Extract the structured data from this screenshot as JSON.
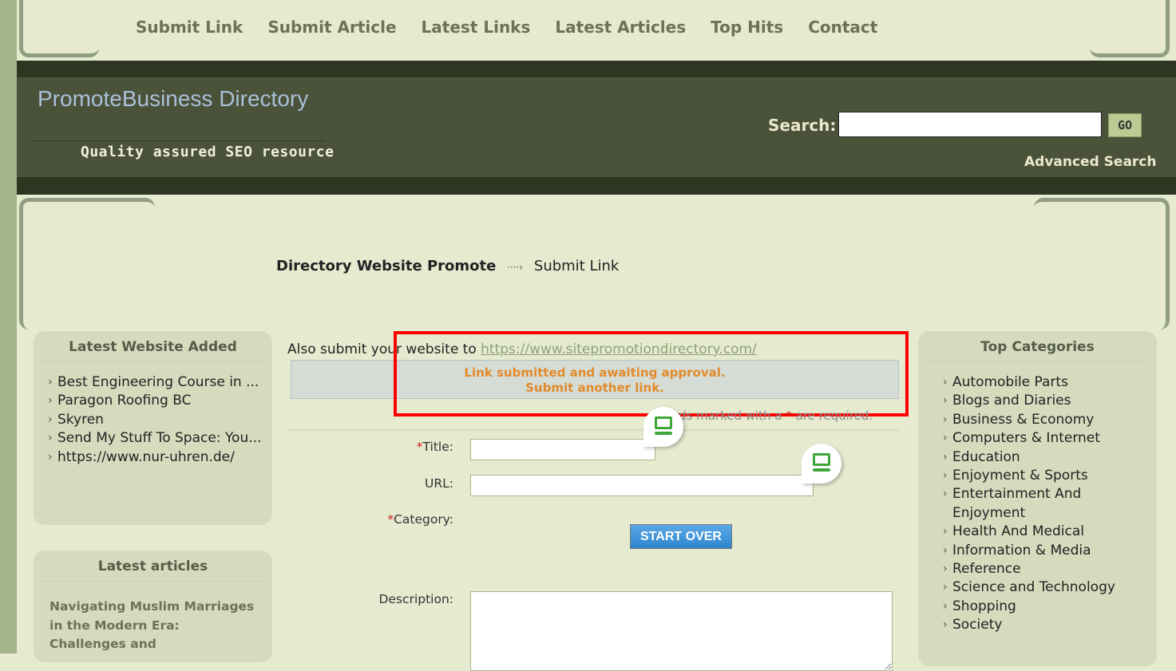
{
  "nav": [
    "Submit Link",
    "Submit Article",
    "Latest Links",
    "Latest Articles",
    "Top Hits",
    "Contact"
  ],
  "header": {
    "title": "PromoteBusiness Directory",
    "tagline": "Quality assured SEO resource",
    "search_label": "Search:",
    "search_value": "",
    "go": "GO",
    "advanced": "Advanced Search"
  },
  "breadcrumb": {
    "home": "Directory Website Promote",
    "sep": "····›",
    "current": "Submit Link"
  },
  "left": {
    "latest_title": "Latest Website Added",
    "latest": [
      "Best Engineering Course in ...",
      "Paragon Roofing BC",
      "Skyren",
      "Send My Stuff To Space: You...",
      "https://www.nur-uhren.de/"
    ],
    "articles_title": "Latest articles",
    "article": "Navigating Muslim Marriages in the Modern Era: Challenges and"
  },
  "main": {
    "also_text": "Also submit your website to ",
    "also_link": "https://www.sitepromotiondirectory.com/",
    "msg1": "Link submitted and awaiting approval.",
    "msg2": "Submit another link.",
    "req_pre": "ds marked with a ",
    "req_star": "*",
    "req_post": " are required.",
    "title_label": "Title:",
    "url_label": "URL:",
    "category_label": "Category:",
    "desc_label": "Description:",
    "star": "*",
    "start_over": "START OVER"
  },
  "right": {
    "title": "Top Categories",
    "items": [
      "Automobile Parts",
      "Blogs and Diaries",
      "Business & Economy",
      "Computers & Internet",
      "Education",
      "Enjoyment & Sports",
      "Entertainment And Enjoyment",
      "Health And Medical",
      "Information & Media",
      "Reference",
      "Science and Technology",
      "Shopping",
      "Society"
    ]
  },
  "colors": {
    "highlight": "#ff0000",
    "message": "#e28a2a"
  }
}
